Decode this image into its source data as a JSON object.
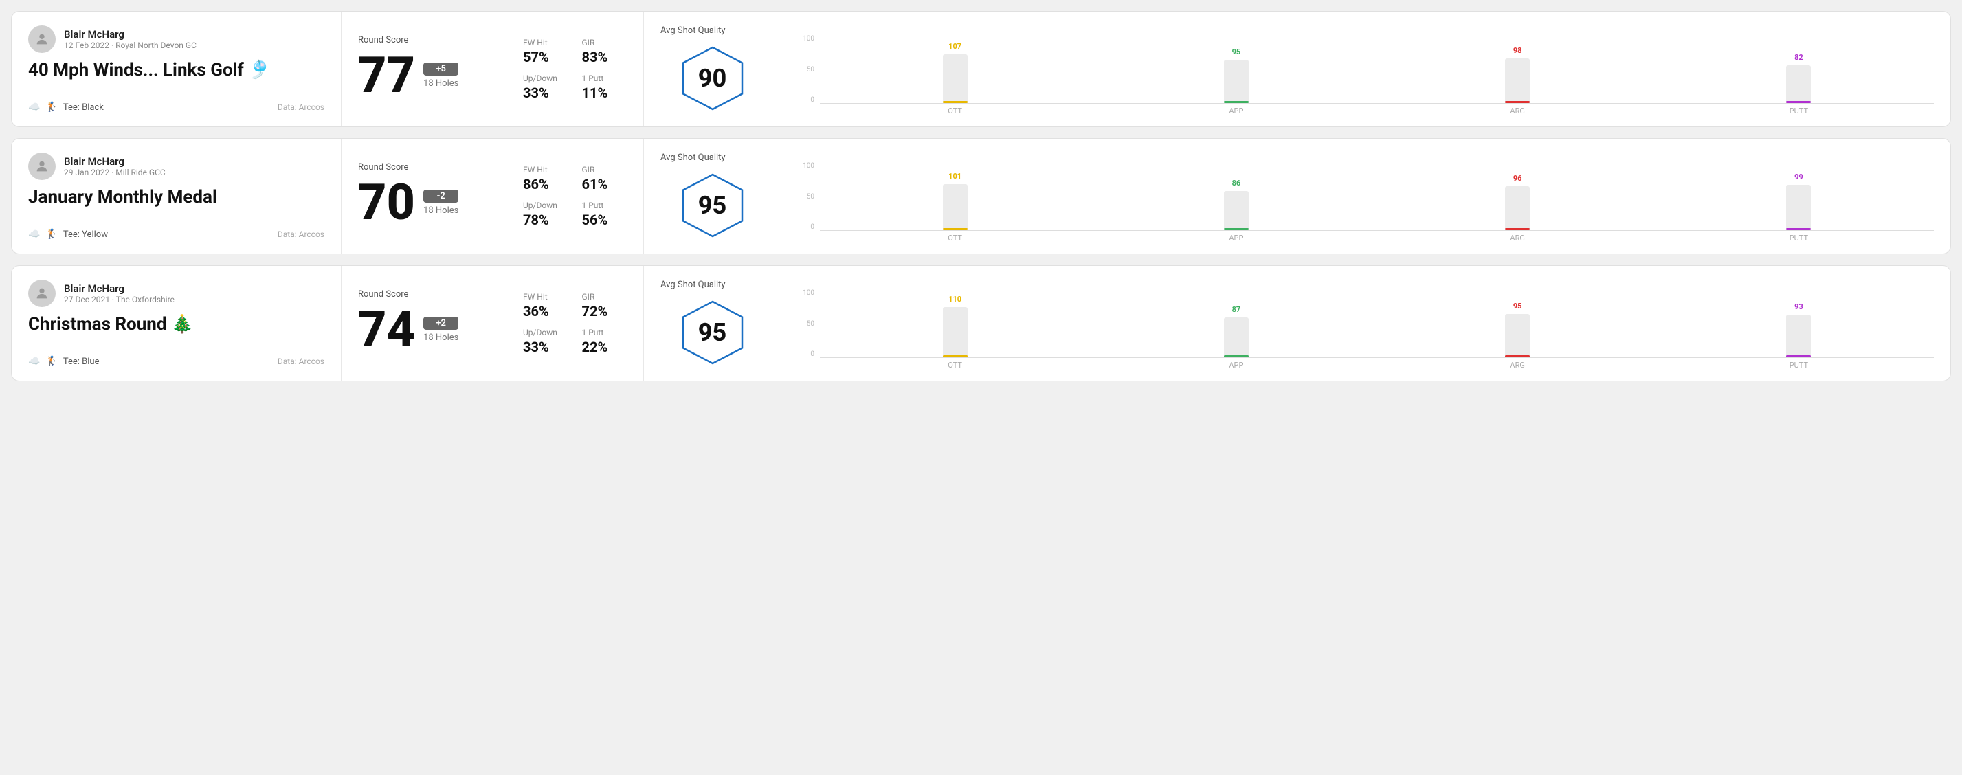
{
  "rounds": [
    {
      "id": "round-1",
      "player_name": "Blair McHarg",
      "date": "12 Feb 2022 · Royal North Devon GC",
      "title": "40 Mph Winds... Links Golf 🎐",
      "tee": "Black",
      "data_source": "Data: Arccos",
      "score": "77",
      "score_diff": "+5",
      "score_diff_type": "plus",
      "holes": "18 Holes",
      "fw_hit": "57%",
      "gir": "83%",
      "up_down": "33%",
      "one_putt": "11%",
      "avg_quality": "90",
      "chart": {
        "bars": [
          {
            "label": "OTT",
            "value": 107,
            "color": "#e8b800",
            "color_class": "bar-ott"
          },
          {
            "label": "APP",
            "value": 95,
            "color": "#3db060",
            "color_class": "bar-app"
          },
          {
            "label": "ARG",
            "value": 98,
            "color": "#e03030",
            "color_class": "bar-arg"
          },
          {
            "label": "PUTT",
            "value": 82,
            "color": "#b030d0",
            "color_class": "bar-putt"
          }
        ],
        "y_labels": [
          "100",
          "50",
          "0"
        ]
      }
    },
    {
      "id": "round-2",
      "player_name": "Blair McHarg",
      "date": "29 Jan 2022 · Mill Ride GCC",
      "title": "January Monthly Medal",
      "tee": "Yellow",
      "data_source": "Data: Arccos",
      "score": "70",
      "score_diff": "-2",
      "score_diff_type": "minus",
      "holes": "18 Holes",
      "fw_hit": "86%",
      "gir": "61%",
      "up_down": "78%",
      "one_putt": "56%",
      "avg_quality": "95",
      "chart": {
        "bars": [
          {
            "label": "OTT",
            "value": 101,
            "color": "#e8b800",
            "color_class": "bar-ott"
          },
          {
            "label": "APP",
            "value": 86,
            "color": "#3db060",
            "color_class": "bar-app"
          },
          {
            "label": "ARG",
            "value": 96,
            "color": "#e03030",
            "color_class": "bar-arg"
          },
          {
            "label": "PUTT",
            "value": 99,
            "color": "#b030d0",
            "color_class": "bar-putt"
          }
        ],
        "y_labels": [
          "100",
          "50",
          "0"
        ]
      }
    },
    {
      "id": "round-3",
      "player_name": "Blair McHarg",
      "date": "27 Dec 2021 · The Oxfordshire",
      "title": "Christmas Round 🎄",
      "tee": "Blue",
      "data_source": "Data: Arccos",
      "score": "74",
      "score_diff": "+2",
      "score_diff_type": "plus",
      "holes": "18 Holes",
      "fw_hit": "36%",
      "gir": "72%",
      "up_down": "33%",
      "one_putt": "22%",
      "avg_quality": "95",
      "chart": {
        "bars": [
          {
            "label": "OTT",
            "value": 110,
            "color": "#e8b800",
            "color_class": "bar-ott"
          },
          {
            "label": "APP",
            "value": 87,
            "color": "#3db060",
            "color_class": "bar-app"
          },
          {
            "label": "ARG",
            "value": 95,
            "color": "#e03030",
            "color_class": "bar-arg"
          },
          {
            "label": "PUTT",
            "value": 93,
            "color": "#b030d0",
            "color_class": "bar-putt"
          }
        ],
        "y_labels": [
          "100",
          "50",
          "0"
        ]
      }
    }
  ],
  "labels": {
    "round_score": "Round Score",
    "fw_hit": "FW Hit",
    "gir": "GIR",
    "up_down": "Up/Down",
    "one_putt": "1 Putt",
    "avg_quality": "Avg Shot Quality",
    "tee_prefix": "Tee: "
  }
}
